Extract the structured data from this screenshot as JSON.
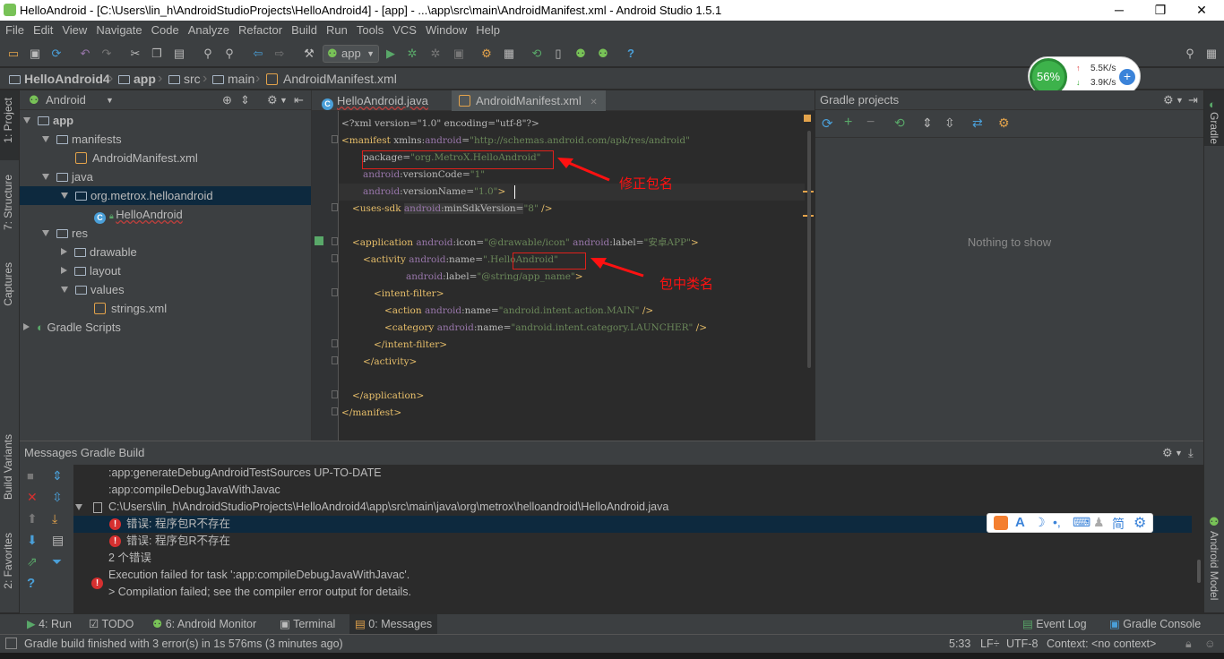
{
  "window": {
    "title": "HelloAndroid - [C:\\Users\\lin_h\\AndroidStudioProjects\\HelloAndroid4] - [app] - ...\\app\\src\\main\\AndroidManifest.xml - Android Studio 1.5.1",
    "minimize": "─",
    "restore": "❐",
    "close": "✕"
  },
  "menu": [
    "File",
    "Edit",
    "View",
    "Navigate",
    "Code",
    "Analyze",
    "Refactor",
    "Build",
    "Run",
    "Tools",
    "VCS",
    "Window",
    "Help"
  ],
  "toolbar": {
    "run_config": "app",
    "help": "?"
  },
  "breadcrumb": [
    "HelloAndroid4",
    "app",
    "src",
    "main",
    "AndroidManifest.xml"
  ],
  "left_strip": {
    "project": "1: Project",
    "structure": "7: Structure",
    "captures": "Captures",
    "build_variants": "Build Variants",
    "favorites": "2: Favorites"
  },
  "project": {
    "view_select": "Android",
    "tree": [
      {
        "label": "app",
        "level": 0,
        "arrow": "down",
        "icon": "module"
      },
      {
        "label": "manifests",
        "level": 1,
        "arrow": "down",
        "icon": "folder"
      },
      {
        "label": "AndroidManifest.xml",
        "level": 2,
        "arrow": "",
        "icon": "xml"
      },
      {
        "label": "java",
        "level": 1,
        "arrow": "down",
        "icon": "folder"
      },
      {
        "label": "org.metrox.helloandroid",
        "level": 2,
        "arrow": "down",
        "icon": "package",
        "selected": true
      },
      {
        "label": "HelloAndroid",
        "level": 3,
        "arrow": "",
        "icon": "class"
      },
      {
        "label": "res",
        "level": 1,
        "arrow": "down",
        "icon": "folder"
      },
      {
        "label": "drawable",
        "level": 2,
        "arrow": "right",
        "icon": "folder"
      },
      {
        "label": "layout",
        "level": 2,
        "arrow": "right",
        "icon": "folder"
      },
      {
        "label": "values",
        "level": 2,
        "arrow": "down",
        "icon": "folder"
      },
      {
        "label": "strings.xml",
        "level": 3,
        "arrow": "",
        "icon": "xml"
      },
      {
        "label": "Gradle Scripts",
        "level": 0,
        "arrow": "right",
        "icon": "gradle"
      }
    ]
  },
  "editor": {
    "tabs": [
      {
        "label": "HelloAndroid.java"
      },
      {
        "label": "AndroidManifest.xml"
      }
    ],
    "lines": [
      {
        "indent": 0,
        "html": "<span class=\"p\">&lt;?xml version=\"1.0\" encoding=\"utf-8\"?&gt;</span>"
      },
      {
        "indent": 0,
        "html": "<span class=\"t\">&lt;manifest </span><span class=\"p\">xmlns:</span><span class=\"a\">android</span><span class=\"p\">=</span><span class=\"s\">\"http://schemas.android.com/apk/res/android\"</span>"
      },
      {
        "indent": 2,
        "html": "<span class=\"p\">package=</span><span class=\"s\">\"org.MetroX.HelloAndroid\"</span>"
      },
      {
        "indent": 2,
        "html": "<span class=\"a\">android</span><span class=\"p\">:versionCode=</span><span class=\"s\">\"1\"</span>"
      },
      {
        "indent": 2,
        "html": "<span class=\"a\">android</span><span class=\"p\">:versionName=</span><span class=\"s\">\"1.0\"</span><span class=\"t\">&gt;</span>"
      },
      {
        "indent": 1,
        "html": "<span class=\"t\">&lt;uses-sdk </span><span class=\"a\" style=\"background:#3b3b3b\">android</span><span class=\"p\" style=\"background:#3b3b3b\">:minSdkVersion=</span><span class=\"s\">\"8\"</span><span class=\"t\"> /&gt;</span>"
      },
      {
        "indent": 0,
        "html": ""
      },
      {
        "indent": 1,
        "html": "<span class=\"t\">&lt;application </span><span class=\"a\">android</span><span class=\"p\">:icon=</span><span class=\"s\">\"@drawable/icon\"</span><span class=\"p\"> </span><span class=\"a\">android</span><span class=\"p\">:label=</span><span class=\"s\">\"安卓APP\"</span><span class=\"t\">&gt;</span>"
      },
      {
        "indent": 2,
        "html": "<span class=\"t\">&lt;activity </span><span class=\"a\">android</span><span class=\"p\">:name=</span><span class=\"s\">\".HelloAndroid\"</span>"
      },
      {
        "indent": 6,
        "html": "<span class=\"a\">android</span><span class=\"p\">:label=</span><span class=\"s\">\"@string/app_name\"</span><span class=\"t\">&gt;</span>"
      },
      {
        "indent": 3,
        "html": "<span class=\"t\">&lt;intent-filter&gt;</span>"
      },
      {
        "indent": 4,
        "html": "<span class=\"t\">&lt;action </span><span class=\"a\">android</span><span class=\"p\">:name=</span><span class=\"s\">\"android.intent.action.MAIN\"</span><span class=\"t\"> /&gt;</span>"
      },
      {
        "indent": 4,
        "html": "<span class=\"t\">&lt;category </span><span class=\"a\">android</span><span class=\"p\">:name=</span><span class=\"s\">\"android.intent.category.LAUNCHER\"</span><span class=\"t\"> /&gt;</span>"
      },
      {
        "indent": 3,
        "html": "<span class=\"t\">&lt;/intent-filter&gt;</span>"
      },
      {
        "indent": 2,
        "html": "<span class=\"t\">&lt;/activity&gt;</span>"
      },
      {
        "indent": 0,
        "html": ""
      },
      {
        "indent": 1,
        "html": "<span class=\"t\">&lt;/application&gt;</span>"
      },
      {
        "indent": 0,
        "html": "<span class=\"t\">&lt;/manifest&gt;</span>"
      }
    ],
    "annotations": {
      "fix_package": "修正包名",
      "class_in_package": "包中类名"
    }
  },
  "gradle": {
    "title": "Gradle projects",
    "empty": "Nothing to show",
    "side_label": "Gradle"
  },
  "messages": {
    "title": "Messages Gradle Build",
    "lines": [
      {
        "text": ":app:generateDebugAndroidTestSources UP-TO-DATE",
        "icon": ""
      },
      {
        "text": ":app:compileDebugJavaWithJavac",
        "icon": ""
      },
      {
        "text": "C:\\Users\\lin_h\\AndroidStudioProjects\\HelloAndroid4\\app\\src\\main\\java\\org\\metrox\\helloandroid\\HelloAndroid.java",
        "icon": "file"
      },
      {
        "text": "错误: 程序包R不存在",
        "icon": "error",
        "selected": true
      },
      {
        "text": "错误: 程序包R不存在",
        "icon": "error"
      },
      {
        "text": "2 个错误",
        "icon": ""
      },
      {
        "text": "Execution failed for task ':app:compileDebugJavaWithJavac'.",
        "icon": "bigerror"
      },
      {
        "text": "> Compilation failed; see the compiler error output for details.",
        "icon": ""
      }
    ]
  },
  "monitor": {
    "percent": "56%",
    "up": "5.5K/s",
    "down": "3.9K/s"
  },
  "ime": {
    "simplified": "简"
  },
  "right_strip": {
    "android_model": "Android Model"
  },
  "bottom_tabs": {
    "run": "4: Run",
    "todo": "TODO",
    "monitor": "6: Android Monitor",
    "terminal": "Terminal",
    "messages": "0: Messages",
    "event_log": "Event Log",
    "gradle_console": "Gradle Console"
  },
  "status": {
    "message": "Gradle build finished with 3 error(s) in 1s 576ms (3 minutes ago)",
    "position": "5:33",
    "line_sep": "LF÷",
    "encoding": "UTF-8",
    "context": "Context: <no context>"
  }
}
